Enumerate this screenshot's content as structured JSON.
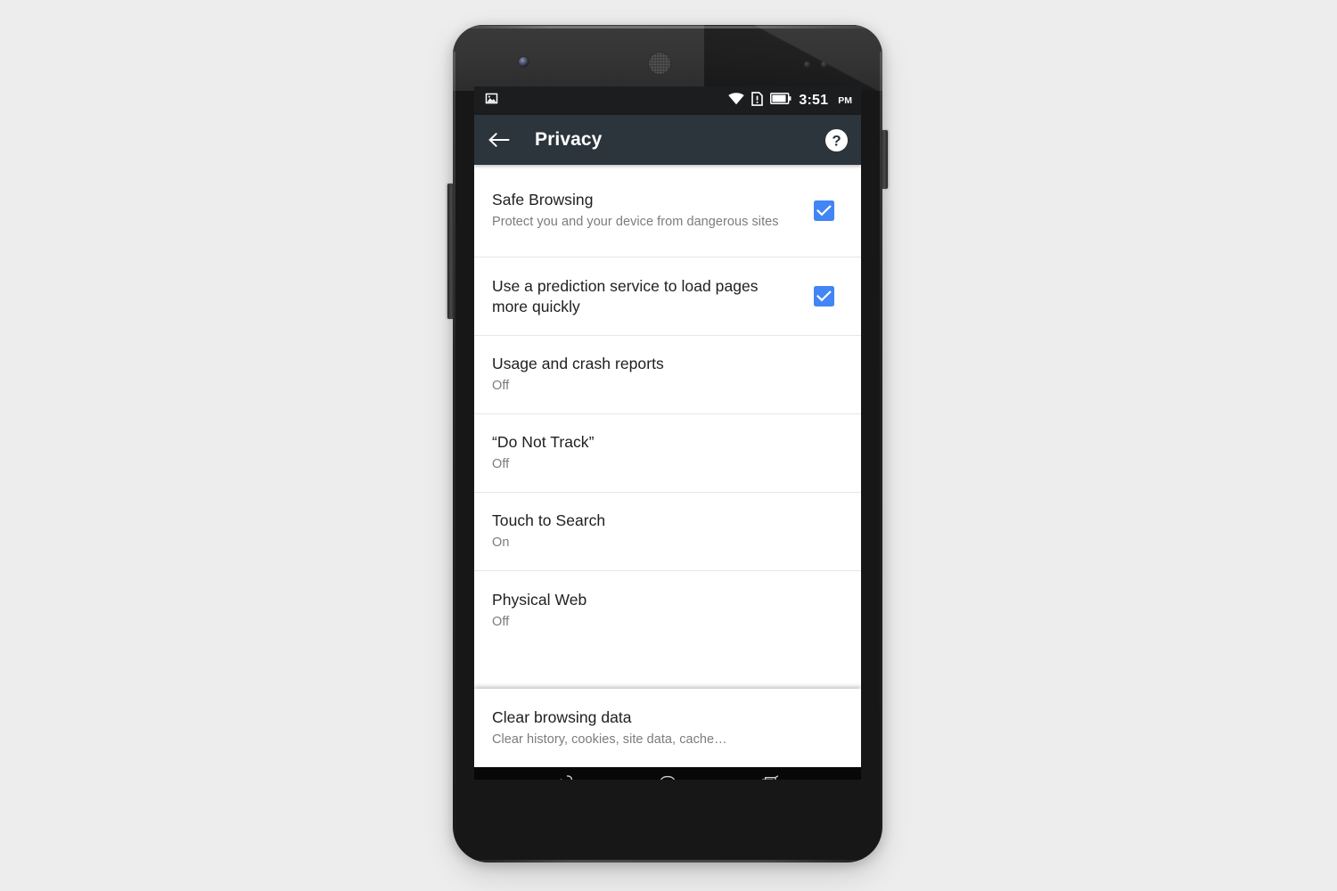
{
  "device": {
    "camera_icon": "front-camera-icon",
    "earpiece_icon": "earpiece-speaker-icon",
    "power_button_label": "Power",
    "volume_button_label": "Volume"
  },
  "status_bar": {
    "notification_icon": "image-notification-icon",
    "wifi_icon": "wifi-icon",
    "sim_icon": "sim-card-alert-icon",
    "battery_icon": "battery-icon",
    "time": "3:51",
    "ampm": "PM"
  },
  "toolbar": {
    "back_icon": "back-arrow-icon",
    "title": "Privacy",
    "help_icon": "help-circle-icon",
    "background_color": "#2c343c"
  },
  "colors": {
    "accent_checkbox": "#4285f4",
    "title_text": "#202020",
    "subtitle_text": "#7c7c7c",
    "divider": "#e6e6e6",
    "page_background": "#ededed"
  },
  "settings": {
    "items": [
      {
        "title": "Safe Browsing",
        "subtitle": "Protect you and your device from dangerous sites",
        "control": "checkbox",
        "checked": true
      },
      {
        "title": "Use a prediction service to load pages more quickly",
        "subtitle": "",
        "control": "checkbox",
        "checked": true
      },
      {
        "title": "Usage and crash reports",
        "subtitle": "Off",
        "control": "none",
        "checked": false
      },
      {
        "title": "“Do Not Track”",
        "subtitle": "Off",
        "control": "none",
        "checked": false
      },
      {
        "title": "Touch to Search",
        "subtitle": "On",
        "control": "none",
        "checked": false
      },
      {
        "title": "Physical Web",
        "subtitle": "Off",
        "control": "none",
        "checked": false
      }
    ],
    "elevated_item": {
      "title": "Clear browsing data",
      "subtitle": "Clear history, cookies, site data, cache…"
    }
  },
  "nav_bar": {
    "back_icon": "nav-back-icon",
    "home_icon": "nav-home-icon",
    "recents_icon": "nav-recents-icon"
  }
}
